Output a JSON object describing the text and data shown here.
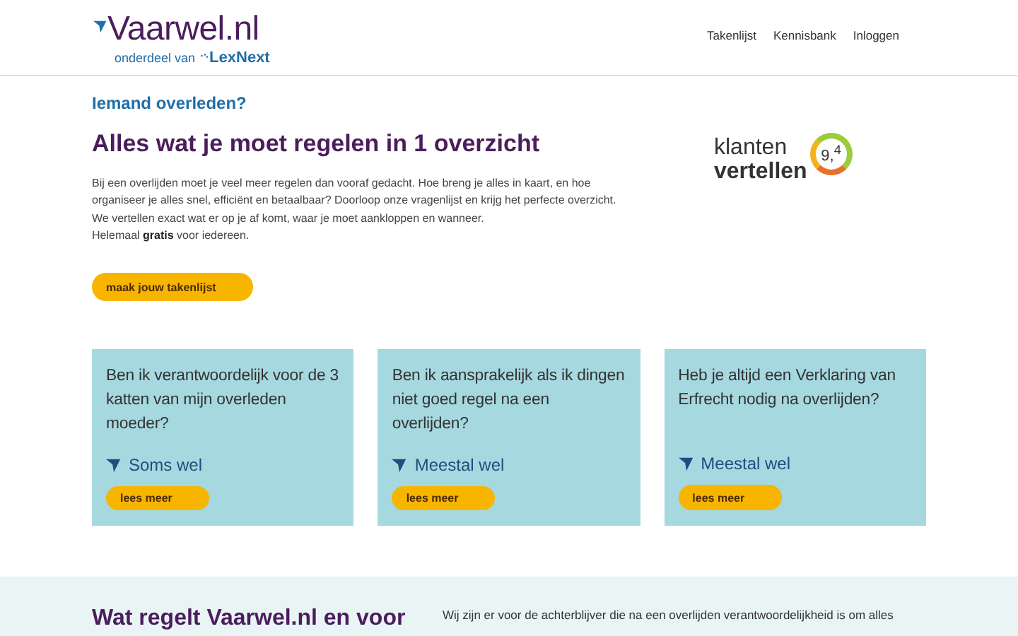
{
  "header": {
    "logo": "Vaarwel.nl",
    "tagline": "onderdeel van",
    "partner": "LexNext",
    "nav": [
      "Takenlijst",
      "Kennisbank",
      "Inloggen"
    ]
  },
  "intro": {
    "kicker": "Iemand overleden?",
    "title": "Alles wat je moet regelen in 1 overzicht",
    "body": "Bij een overlijden moet je veel meer regelen dan vooraf gedacht. Hoe breng je alles in kaart, en hoe organiseer je alles snel, efficiënt en betaalbaar? Doorloop onze vragenlijst en krijg het perfecte overzicht. We vertellen exact wat er op je af komt, waar je moet aankloppen en wanneer.",
    "body2": "Helemaal **gratis** voor iedereen.",
    "button": "maak jouw takenlijst"
  },
  "rating": {
    "line1": "klanten",
    "line2": "vertellen",
    "score": "9,$^{4}$"
  },
  "cards": [
    {
      "question": "Ben ik verantwoordelijk voor de 3 katten van mijn overleden moeder?",
      "answer": "Soms wel",
      "button": "lees meer"
    },
    {
      "question": "Ben ik aansprakelijk als ik dingen niet goed regel na een overlijden?",
      "answer": "Meestal wel",
      "button": "lees meer"
    },
    {
      "question": "Heb je altijd een Verklaring van Erfrecht nodig na overlijden?",
      "answer": "Meestal wel",
      "button": "lees meer"
    }
  ],
  "bottom": {
    "title": "Wat regelt Vaarwel.nl en voor",
    "text": "Wij zijn er voor de achterblijver die na een overlijden verantwoordelijkheid is om alles"
  }
}
